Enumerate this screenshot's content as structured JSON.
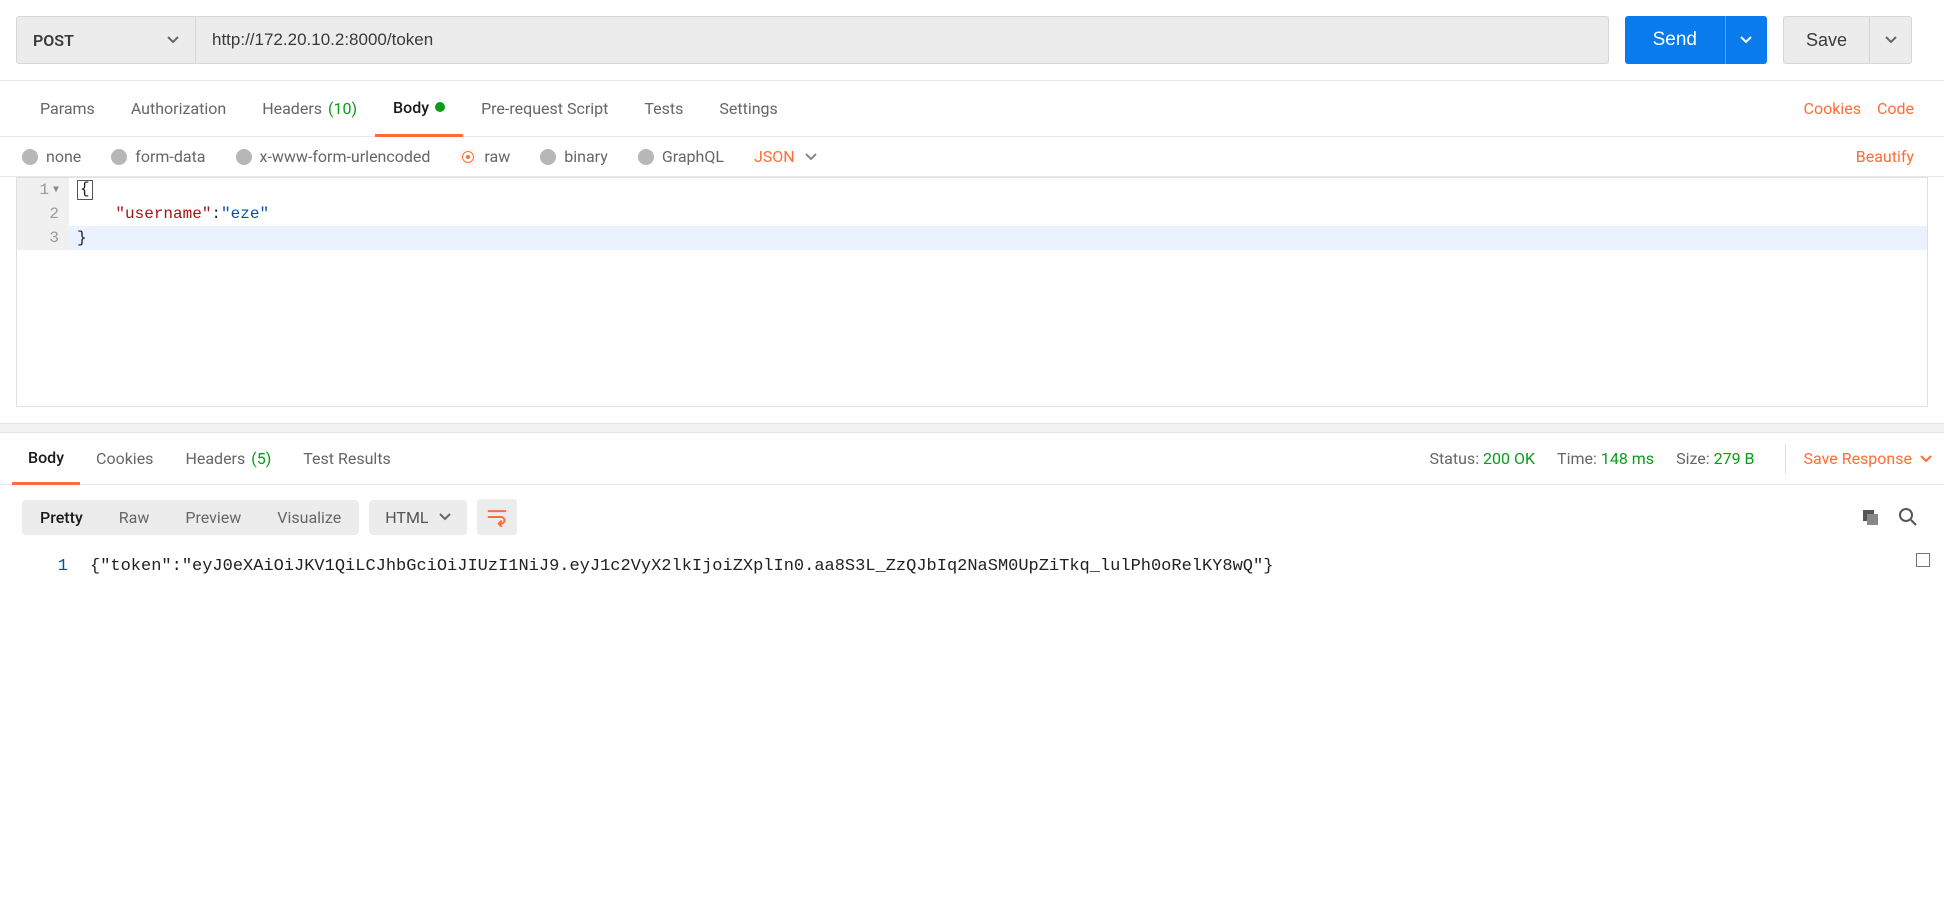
{
  "request": {
    "method": "POST",
    "url": "http://172.20.10.2:8000/token",
    "send_label": "Send",
    "save_label": "Save"
  },
  "tabs": {
    "params": "Params",
    "authorization": "Authorization",
    "headers": "Headers",
    "headers_count": "(10)",
    "body": "Body",
    "prerequest": "Pre-request Script",
    "tests": "Tests",
    "settings": "Settings",
    "cookies_link": "Cookies",
    "code_link": "Code"
  },
  "body_types": {
    "none": "none",
    "form_data": "form-data",
    "urlencoded": "x-www-form-urlencoded",
    "raw": "raw",
    "binary": "binary",
    "graphql": "GraphQL",
    "lang": "JSON",
    "beautify": "Beautify"
  },
  "editor_lines": {
    "l1_num": "1",
    "l1_code_open": "{",
    "l2_num": "2",
    "l2_key": "\"username\"",
    "l2_sep": ":",
    "l2_val": "\"eze\"",
    "l3_num": "3",
    "l3_code_close": "}"
  },
  "response_tabs": {
    "body": "Body",
    "cookies": "Cookies",
    "headers": "Headers",
    "headers_count": "(5)",
    "test_results": "Test Results"
  },
  "response_meta": {
    "status_label": "Status:",
    "status_value": "200 OK",
    "time_label": "Time:",
    "time_value": "148 ms",
    "size_label": "Size:",
    "size_value": "279 B",
    "save_response": "Save Response"
  },
  "response_view": {
    "pretty": "Pretty",
    "raw": "Raw",
    "preview": "Preview",
    "visualize": "Visualize",
    "format": "HTML"
  },
  "response_body": {
    "line_num": "1",
    "content": "{\"token\":\"eyJ0eXAiOiJKV1QiLCJhbGciOiJIUzI1NiJ9.eyJ1c2VyX2lkIjoiZXplIn0.aa8S3L_ZzQJbIq2NaSM0UpZiTkq_lulPh0oRelKY8wQ\"}"
  }
}
